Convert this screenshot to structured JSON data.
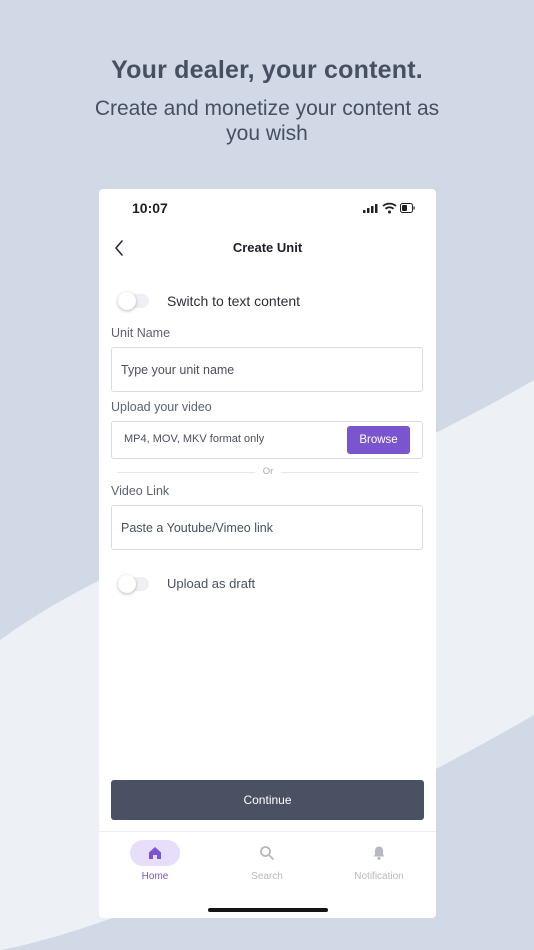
{
  "marketing": {
    "headline": "Your dealer, your content.",
    "subline": "Create and monetize your content as you wish"
  },
  "status_bar": {
    "time": "10:07",
    "icons": [
      "signal-icon",
      "wifi-icon",
      "battery-icon"
    ]
  },
  "header": {
    "back_icon": "chevron-left-icon",
    "title": "Create Unit"
  },
  "switch_text_content": {
    "label": "Switch to text content",
    "on": false
  },
  "unit_name": {
    "label": "Unit Name",
    "placeholder": "Type your unit name",
    "value": ""
  },
  "upload": {
    "label": "Upload your video",
    "hint": "MP4, MOV, MKV format only",
    "button": "Browse"
  },
  "divider": {
    "text": "Or"
  },
  "video_link": {
    "label": "Video Link",
    "placeholder": "Paste a Youtube/Vimeo link",
    "value": ""
  },
  "draft": {
    "label": "Upload as draft",
    "on": false
  },
  "continue_button": "Continue",
  "tabs": [
    {
      "label": "Home",
      "icon": "home-icon",
      "active": true
    },
    {
      "label": "Search",
      "icon": "search-icon",
      "active": false
    },
    {
      "label": "Notification",
      "icon": "bell-icon",
      "active": false
    }
  ],
  "colors": {
    "accent": "#7b55cf",
    "accent_light": "#e6defa",
    "button_dark": "#4a5162",
    "background": "#d0d9e5",
    "wave": "#eef1f6"
  }
}
